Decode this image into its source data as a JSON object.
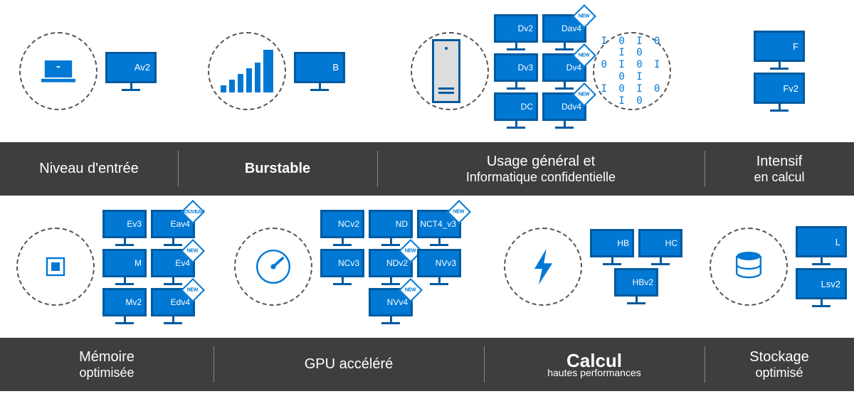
{
  "row1": {
    "entry_level": {
      "label": "Niveau d'entrée",
      "monitors": [
        "Av2"
      ]
    },
    "burstable": {
      "label": "Burstable",
      "monitors": [
        "B"
      ]
    },
    "general": {
      "label_line1": "Usage général et",
      "label_line2": "Informatique confidentielle",
      "monitors": [
        [
          {
            "t": "Dv2"
          },
          {
            "t": "Dav4",
            "new": "NEW"
          }
        ],
        [
          {
            "t": "Dv3"
          },
          {
            "t": "Dv4",
            "new": "NEW"
          }
        ],
        [
          {
            "t": "DC"
          },
          {
            "t": "Ddv4",
            "new": "NEW"
          }
        ]
      ]
    },
    "compute": {
      "label_line1": "Intensif",
      "label_line2": "en calcul",
      "monitors": [
        "F",
        "Fv2"
      ]
    }
  },
  "row2": {
    "memory": {
      "label_line1": "Mémoire",
      "label_line2": "optimisée",
      "monitors": [
        [
          {
            "t": "Ev3"
          },
          {
            "t": "Eav4",
            "new": "NOUVEAU"
          }
        ],
        [
          {
            "t": "M"
          },
          {
            "t": "Ev4",
            "new": "NEW"
          }
        ],
        [
          {
            "t": "Mv2"
          },
          {
            "t": "Edv4",
            "new": "NEW"
          }
        ]
      ]
    },
    "gpu": {
      "label": "GPU accéléré",
      "monitors": [
        [
          {
            "t": "NCv2"
          },
          {
            "t": "ND"
          },
          {
            "t": "NCT4_v3",
            "new": "NEW"
          }
        ],
        [
          {
            "t": "NCv3"
          },
          {
            "t": "NDv2",
            "new": "NEW"
          },
          {
            "t": "NVv3"
          }
        ],
        [
          null,
          {
            "t": "NVv4",
            "new": "NEW"
          },
          null
        ]
      ]
    },
    "hpc": {
      "label_line1": "Calcul",
      "label_line2": "hautes performances",
      "monitors": [
        [
          {
            "t": "HB"
          },
          {
            "t": "HC"
          }
        ],
        [
          {
            "t": "HBv2"
          }
        ]
      ]
    },
    "storage": {
      "label_line1": "Stockage",
      "label_line2": "optimisé",
      "monitors": [
        "L",
        "Lsv2"
      ]
    }
  },
  "binary_lines": [
    "I 0 I 0 I 0",
    "0 I 0 I 0 I",
    "I 0 I 0 I 0"
  ]
}
